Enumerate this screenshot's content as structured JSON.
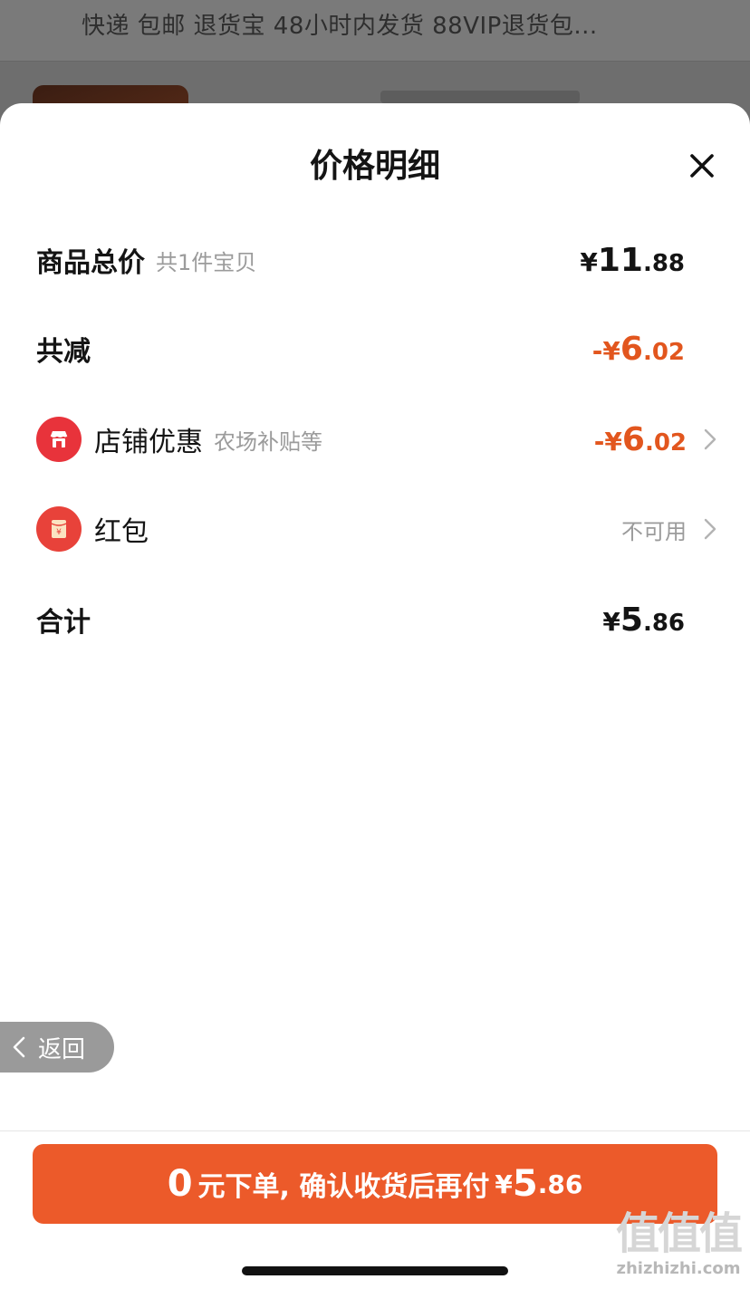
{
  "background": {
    "tags_text": "快递 包邮 退货宝 48小时内发货 88VIP退货包..."
  },
  "sheet": {
    "title": "价格明细"
  },
  "rows": {
    "goods_total": {
      "label": "商品总价",
      "sub": "共1件宝贝",
      "sym": "¥",
      "int": "11",
      "dec": ".88"
    },
    "discount_total": {
      "label": "共减",
      "sym": "-¥",
      "int": "6",
      "dec": ".02"
    },
    "shop_discount": {
      "label": "店铺优惠",
      "sub": "农场补贴等",
      "sym": "-¥",
      "int": "6",
      "dec": ".02"
    },
    "red_packet": {
      "label": "红包",
      "status": "不可用",
      "icon_glyph": "¥"
    },
    "grand_total": {
      "label": "合计",
      "sym": "¥",
      "int": "5",
      "dec": ".86"
    }
  },
  "back_button": {
    "label": "返回"
  },
  "cta": {
    "zero": "0",
    "text": "元下单, 确认收货后再付",
    "sym": "¥",
    "int": "5",
    "dec": ".86"
  },
  "watermark": {
    "logo": "值值值",
    "domain": "zhizhizhi.com"
  },
  "colors": {
    "accent_orange": "#ec5a2a",
    "discount_orange": "#e2561e",
    "icon_red": "#e8333b"
  },
  "icons": {
    "close": "close-icon",
    "chevron": "chevron-right-icon",
    "shop": "shop-icon",
    "red_packet": "red-packet-icon",
    "back": "chevron-left-icon"
  }
}
